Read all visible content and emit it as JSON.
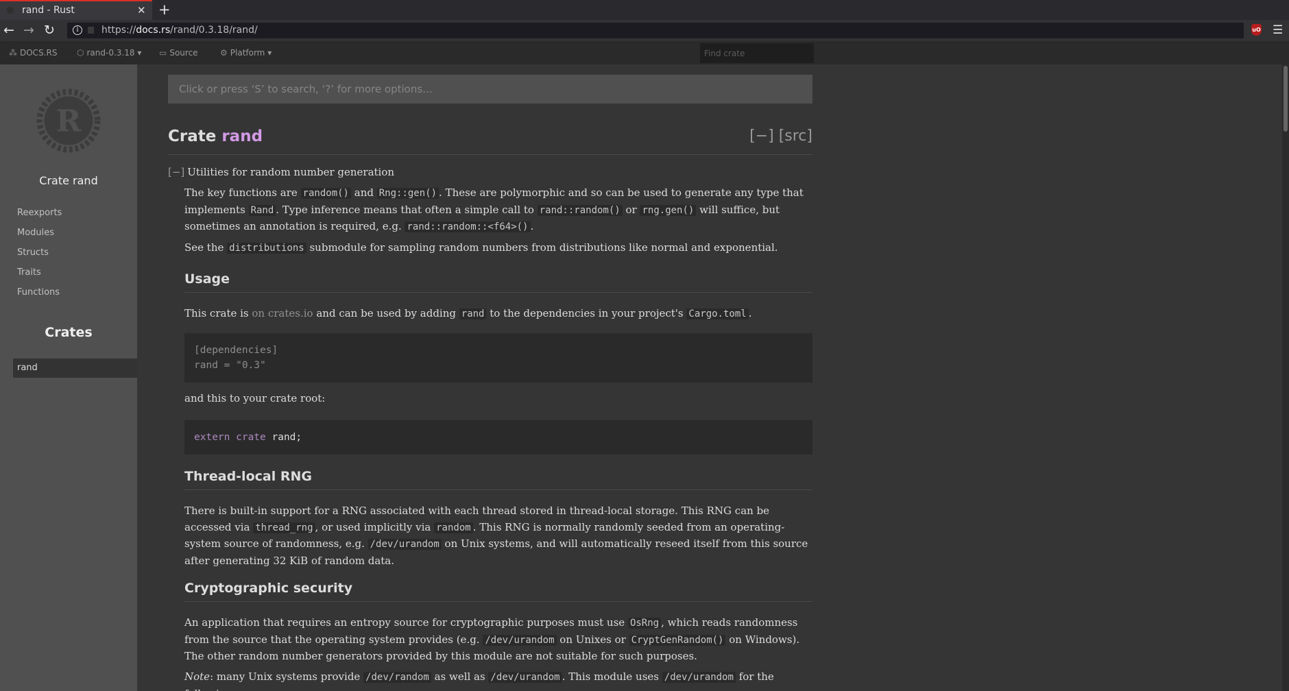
{
  "browser": {
    "tab_title": "rand - Rust",
    "tab_close": "✕",
    "new_tab": "+",
    "url_prefix": "https://",
    "url_host": "docs.rs",
    "url_path": "/rand/0.3.18/rand/",
    "back": "←",
    "forward": "→",
    "reload": "↻",
    "menu": "☰",
    "ublock_label": "uO"
  },
  "docsbar": {
    "docsrs": "DOCS.RS",
    "crate_version": "rand-0.3.18",
    "crate_version_caret": "▾",
    "source": "Source",
    "platform": "Platform",
    "platform_caret": "▾",
    "find_crate_placeholder": "Find crate"
  },
  "sidebar": {
    "crate_title": "Crate rand",
    "links": [
      "Reexports",
      "Modules",
      "Structs",
      "Traits",
      "Functions"
    ],
    "crates_heading": "Crates",
    "crates": [
      "rand"
    ]
  },
  "main": {
    "search_placeholder": "Click or press ‘S’ to search, ‘?’ for more options…",
    "title_kind": "Crate ",
    "title_name": "rand",
    "collapse": "[−]",
    "src": "[src]",
    "toggle": "[−]",
    "summary": "Utilities for random number generation",
    "p1": {
      "t1": "The key functions are ",
      "c1": "random()",
      "t2": " and ",
      "c2": "Rng::gen()",
      "t3": ". These are polymorphic and so can be used to generate any type that implements ",
      "c3": "Rand",
      "t4": ". Type inference means that often a simple call to ",
      "c4": "rand::random()",
      "t5": " or ",
      "c5": "rng.gen()",
      "t6": " will suffice, but sometimes an annotation is required, e.g. ",
      "c6": "rand::random::<f64>()",
      "t7": "."
    },
    "p2": {
      "t1": "See the ",
      "c1": "distributions",
      "t2": " submodule for sampling random numbers from distributions like normal and exponential."
    },
    "h_usage": "Usage",
    "p3": {
      "t1": "This crate is ",
      "link": "on crates.io",
      "t2": " and can be used by adding ",
      "c1": "rand",
      "t3": " to the dependencies in your project's ",
      "c2": "Cargo.toml",
      "t4": "."
    },
    "code1_line1": "[dependencies]",
    "code1_line2": "rand = \"0.3\"",
    "p4": "and this to your crate root:",
    "code2_kw": "extern crate",
    "code2_rest": " rand;",
    "h_thread": "Thread-local RNG",
    "p5": {
      "t1": "There is built-in support for a RNG associated with each thread stored in thread-local storage. This RNG can be accessed via ",
      "c1": "thread_rng",
      "t2": ", or used implicitly via ",
      "c2": "random",
      "t3": ". This RNG is normally randomly seeded from an operating-system source of randomness, e.g. ",
      "c3": "/dev/urandom",
      "t4": " on Unix systems, and will automatically reseed itself from this source after generating 32 KiB of random data."
    },
    "h_crypto": "Cryptographic security",
    "p6": {
      "t1": "An application that requires an entropy source for cryptographic purposes must use ",
      "c1": "OsRng",
      "t2": ", which reads randomness from the source that the operating system provides (e.g. ",
      "c2": "/dev/urandom",
      "t3": " on Unixes or ",
      "c3": "CryptGenRandom()",
      "t4": " on Windows). The other random number generators provided by this module are not suitable for such purposes."
    },
    "p7": {
      "note": "Note",
      "t1": ": many Unix systems provide ",
      "c1": "/dev/random",
      "t2": " as well as ",
      "c2": "/dev/urandom",
      "t3": ". This module uses ",
      "c3": "/dev/urandom",
      "t4": " for the following reasons:"
    }
  }
}
